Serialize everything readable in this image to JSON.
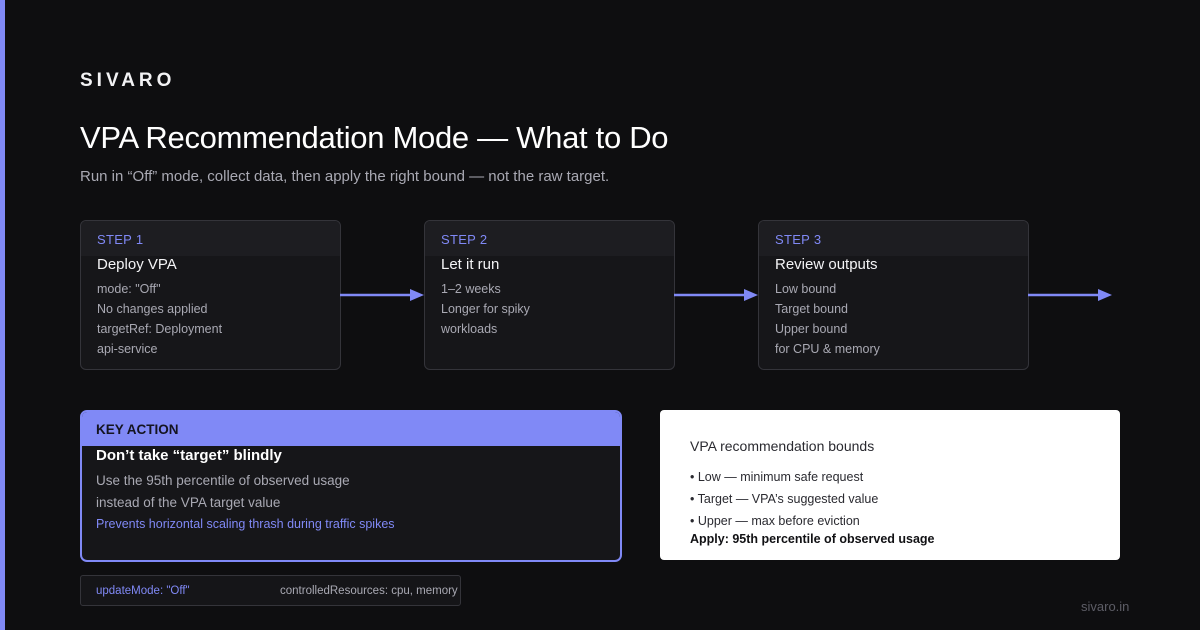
{
  "brand": "SIVARO",
  "title": "VPA Recommendation Mode — What to Do",
  "subtitle": "Run in “Off” mode, collect data, then apply the right bound — not the raw target.",
  "steps": [
    {
      "label": "STEP 1",
      "title": "Deploy VPA",
      "lines": [
        "mode: \"Off\"",
        "No changes applied",
        "targetRef: Deployment",
        "api-service"
      ]
    },
    {
      "label": "STEP 2",
      "title": "Let it run",
      "lines": [
        "1–2 weeks",
        "Longer for spiky",
        "workloads"
      ]
    },
    {
      "label": "STEP 3",
      "title": "Review outputs",
      "lines": [
        "Low bound",
        "Target bound",
        "Upper bound",
        "for CPU & memory"
      ]
    }
  ],
  "key_action": {
    "label": "KEY ACTION",
    "title": "Don’t take “target” blindly",
    "lines": [
      "Use the 95th percentile of observed usage",
      "instead of the VPA target value"
    ],
    "note": "Prevents horizontal scaling thrash during traffic spikes"
  },
  "bounds": {
    "title": "VPA recommendation bounds",
    "items": [
      "• Low — minimum safe request",
      "• Target — VPA’s suggested value",
      "• Upper — max before eviction"
    ],
    "apply": "Apply: 95th percentile of observed usage"
  },
  "code": {
    "update_mode": "updateMode: \"Off\"",
    "controlled": "controlledResources: cpu, memory"
  },
  "footer_url": "sivaro.in",
  "colors": {
    "accent": "#8089f6",
    "background": "#0e0e10",
    "card": "#161619"
  }
}
